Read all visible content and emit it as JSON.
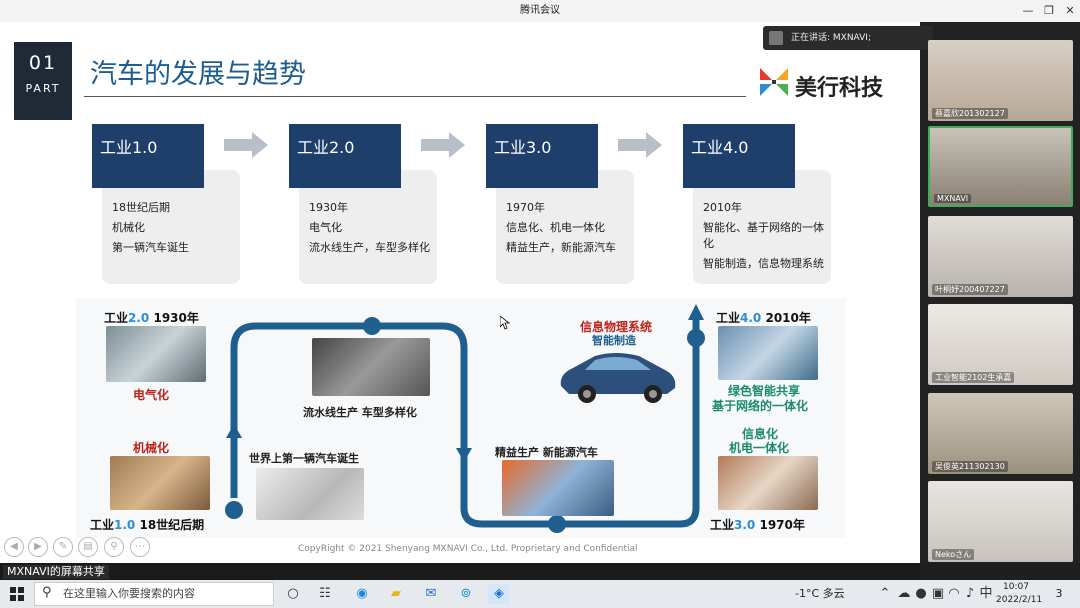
{
  "window": {
    "title": "腾讯会议"
  },
  "slide": {
    "part_number": "01",
    "part_word": "PART",
    "title": "汽车的发展与趋势",
    "brand_name": "美行科技",
    "stages": [
      {
        "name": "工业1.0",
        "points": [
          "18世纪后期",
          "机械化",
          "第一辆汽车诞生"
        ]
      },
      {
        "name": "工业2.0",
        "points": [
          "1930年",
          "电气化",
          "流水线生产，车型多样化"
        ]
      },
      {
        "name": "工业3.0",
        "points": [
          "1970年",
          "信息化、机电一体化",
          "精益生产，新能源汽车"
        ]
      },
      {
        "name": "工业4.0",
        "points": [
          "2010年",
          "智能化、基于网络的一体化",
          "智能制造，信息物理系统"
        ]
      }
    ],
    "diagram": {
      "era1_prefix": "工业",
      "era1_hl": "1.0",
      "era1_year": "18世纪后期",
      "era2_prefix": "工业",
      "era2_hl": "2.0",
      "era2_year": "1930年",
      "era3_prefix": "工业",
      "era3_hl": "3.0",
      "era3_year": "1970年",
      "era4_prefix": "工业",
      "era4_hl": "4.0",
      "era4_year": "2010年",
      "mechanization": "机械化",
      "electrification": "电气化",
      "first_car": "世界上第一辆汽车诞生",
      "assembly_line": "流水线生产  车型多样化",
      "lean_production": "精益生产  新能源汽车",
      "cps_line1": "信息物理系统",
      "cps_line2": "智能制造",
      "green_line1": "绿色智能共享",
      "green_line2": "基于网络的一体化",
      "info_line1": "信息化",
      "info_line2": "机电一体化"
    },
    "copyright": "CopyRight © 2021 Shenyang MXNAVI Co., Ltd.  Proprietary and Confidential"
  },
  "speaking_text": "正在讲话: MXNAVI;",
  "participants": [
    {
      "name": "蔡嘉欣201302127"
    },
    {
      "name": "MXNAVI"
    },
    {
      "name": "叶桐妤200407227"
    },
    {
      "name": "工业智能2102生承嘉"
    },
    {
      "name": "吴俊英211302130"
    },
    {
      "name": "Nekoさん"
    }
  ],
  "share_label": "MXNAVI的屏幕共享",
  "taskbar": {
    "search_placeholder": "在这里输入你要搜索的内容",
    "weather": "-1°C 多云",
    "ime": "中",
    "time": "10:07",
    "date": "2022/2/11",
    "notification_count": "3"
  },
  "colors": {
    "stage_head": "#1e3e6b",
    "title_blue": "#1d5d8f",
    "loop_blue": "#1f5f8f"
  }
}
